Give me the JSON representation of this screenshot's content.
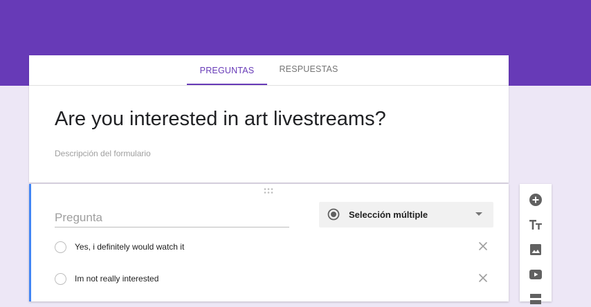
{
  "tabs": {
    "questions": "PREGUNTAS",
    "responses": "RESPUESTAS"
  },
  "form": {
    "title": "Are you interested in art livestreams?",
    "description_placeholder": "Descripción del formulario"
  },
  "question": {
    "title_placeholder": "Pregunta",
    "type": "Selección múltiple",
    "options": [
      "Yes, i definitely would watch it",
      "Im not really interested"
    ]
  },
  "toolbar": {
    "icons": [
      "add-question-icon",
      "add-title-icon",
      "add-image-icon",
      "add-video-icon",
      "add-section-icon"
    ]
  },
  "colors": {
    "header": "#673ab7",
    "background": "#ede7f6",
    "accent": "#4285f4"
  }
}
